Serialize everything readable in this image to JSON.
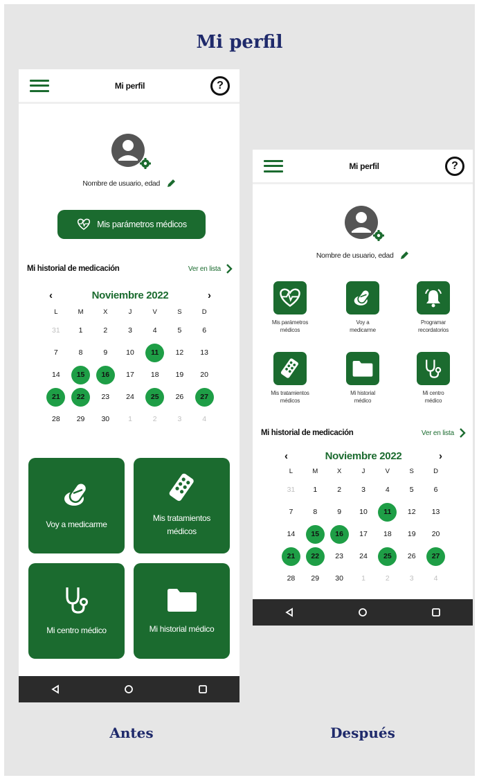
{
  "title": "Mi perfil",
  "captions": {
    "before": "Antes",
    "after": "Después"
  },
  "colors": {
    "brand_green": "#1b6b2f",
    "marked_day": "#1e9e46",
    "title_navy": "#1f2a6b"
  },
  "phone_before": {
    "appbar_title": "Mi perfil",
    "username": "Nombre de usuario, edad",
    "params_button": "Mis parámetros médicos",
    "history_title": "Mi historial de medicación",
    "view_list": "Ver en lista",
    "calendar": {
      "month": "Noviembre 2022",
      "weekdays": [
        "L",
        "M",
        "X",
        "J",
        "V",
        "S",
        "D"
      ],
      "weeks": [
        [
          [
            "31",
            "other"
          ],
          [
            "1",
            ""
          ],
          [
            "2",
            ""
          ],
          [
            "3",
            ""
          ],
          [
            "4",
            ""
          ],
          [
            "5",
            ""
          ],
          [
            "6",
            ""
          ]
        ],
        [
          [
            "7",
            ""
          ],
          [
            "8",
            ""
          ],
          [
            "9",
            ""
          ],
          [
            "10",
            ""
          ],
          [
            "11",
            "mark"
          ],
          [
            "12",
            ""
          ],
          [
            "13",
            ""
          ]
        ],
        [
          [
            "14",
            ""
          ],
          [
            "15",
            "mark"
          ],
          [
            "16",
            "mark"
          ],
          [
            "17",
            ""
          ],
          [
            "18",
            ""
          ],
          [
            "19",
            ""
          ],
          [
            "20",
            ""
          ]
        ],
        [
          [
            "21",
            "mark"
          ],
          [
            "22",
            "mark"
          ],
          [
            "23",
            ""
          ],
          [
            "24",
            ""
          ],
          [
            "25",
            "mark"
          ],
          [
            "26",
            ""
          ],
          [
            "27",
            "mark"
          ]
        ],
        [
          [
            "28",
            ""
          ],
          [
            "29",
            ""
          ],
          [
            "30",
            ""
          ],
          [
            "1",
            "other"
          ],
          [
            "2",
            "other"
          ],
          [
            "3",
            "other"
          ],
          [
            "4",
            "other"
          ]
        ]
      ]
    },
    "tiles": [
      "Voy a medicarme",
      "Mis tratamientos médicos",
      "Mi centro médico",
      "Mi historial médico"
    ],
    "icons": [
      "pill-icon",
      "pill-pack-icon",
      "stethoscope-icon",
      "folder-icon",
      "heart-pulse-icon",
      "gear-icon",
      "pencil-icon"
    ]
  },
  "phone_after": {
    "appbar_title": "Mi perfil",
    "username": "Nombre de usuario, edad",
    "grid": [
      [
        "Mis parámetros",
        "médicos"
      ],
      [
        "Voy a",
        "medicarme"
      ],
      [
        "Programar",
        "recordatorios"
      ],
      [
        "Mis tratamientos",
        "médicos"
      ],
      [
        "Mi historial",
        "médico"
      ],
      [
        "Mi centro",
        "médico"
      ]
    ],
    "history_title": "Mi historial de medicación",
    "view_list": "Ver en lista",
    "calendar": {
      "month": "Noviembre 2022"
    },
    "icons": [
      "heart-pulse-icon",
      "pill-icon",
      "bell-icon",
      "pill-pack-icon",
      "folder-icon",
      "stethoscope-icon"
    ]
  }
}
